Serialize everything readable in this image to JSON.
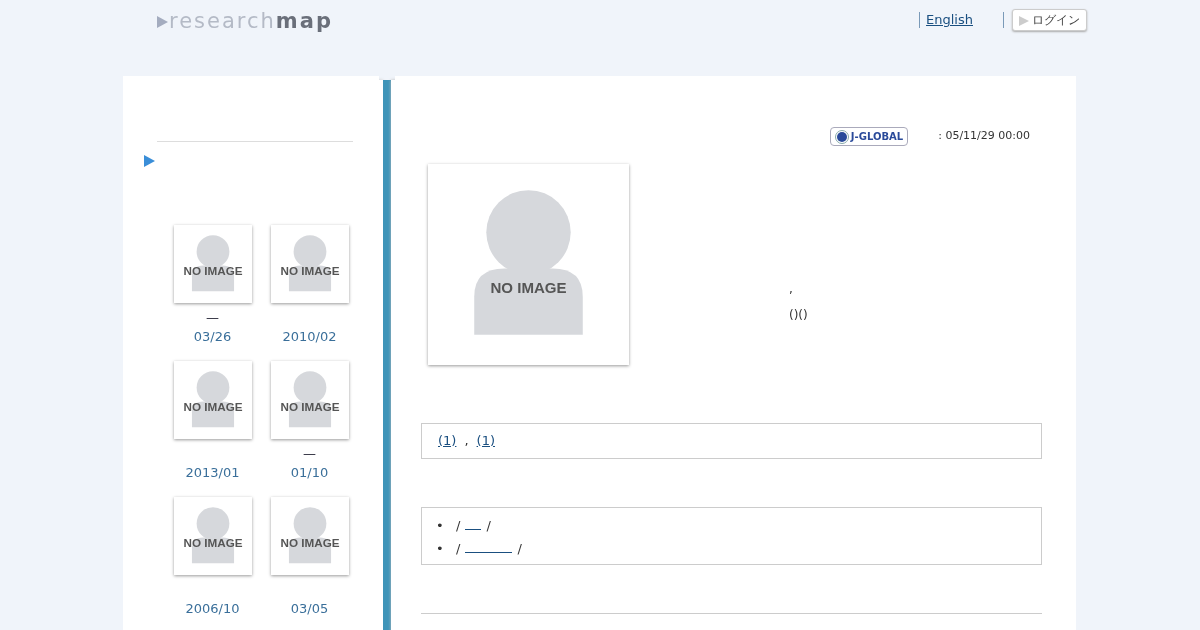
{
  "header": {
    "logo_light": "research",
    "logo_dark": "map",
    "language_link": "English",
    "login_button": "ログイン"
  },
  "sidebar": {
    "people": [
      {
        "dash": "—",
        "date": "03/26",
        "placeholder_text": "NO IMAGE"
      },
      {
        "date": "2010/02",
        "placeholder_text": "NO IMAGE"
      },
      {
        "date": "2013/01",
        "placeholder_text": "NO IMAGE"
      },
      {
        "dash": "—",
        "date": "01/10",
        "placeholder_text": "NO IMAGE"
      },
      {
        "date": "2006/10",
        "placeholder_text": "NO IMAGE"
      },
      {
        "date": "03/05",
        "placeholder_text": "NO IMAGE"
      }
    ]
  },
  "profile": {
    "badge": "J-GLOBAL",
    "updated": ": 05/11/29 00:00",
    "photo_text": "NO IMAGE",
    "lines": [
      ",",
      "()()"
    ]
  },
  "links_box": {
    "links": [
      "(1)",
      "(1)"
    ],
    "separator": ","
  },
  "list_box": {
    "items": [
      {
        "bullet": "•",
        "before": "/",
        "after": "/",
        "kind": "short"
      },
      {
        "bullet": "•",
        "before": "/",
        "after": "/",
        "kind": "long"
      }
    ]
  }
}
